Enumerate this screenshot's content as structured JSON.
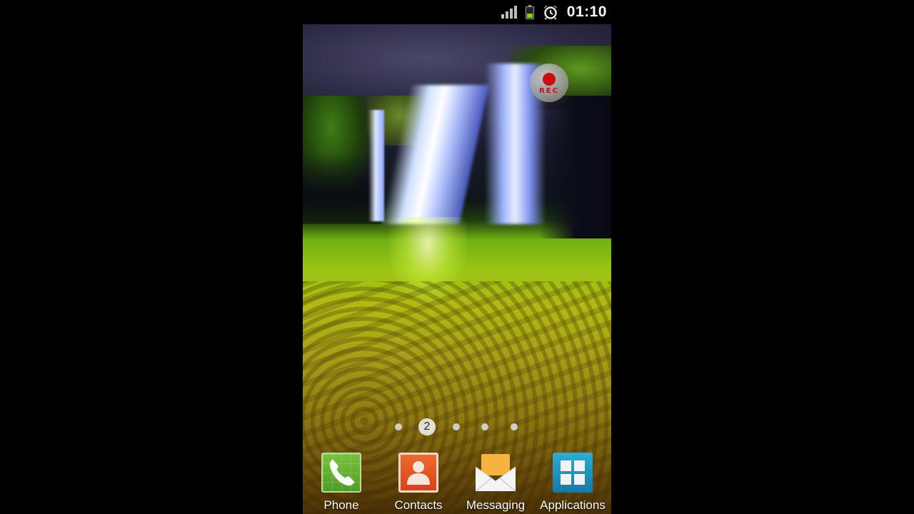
{
  "status_bar": {
    "time": "01:10",
    "signal_icon": "signal-bars-icon",
    "battery_icon": "battery-icon",
    "battery_level": 0.35,
    "alarm_icon": "alarm-clock-icon"
  },
  "overlay": {
    "rec_label": "REC",
    "rec_icon": "record-icon"
  },
  "home": {
    "wallpaper": "waterfall",
    "current_page": "2",
    "page_count": 5
  },
  "dock": {
    "items": [
      {
        "label": "Phone",
        "icon": "phone-icon"
      },
      {
        "label": "Contacts",
        "icon": "contacts-icon"
      },
      {
        "label": "Messaging",
        "icon": "messaging-icon"
      },
      {
        "label": "Applications",
        "icon": "apps-grid-icon"
      }
    ]
  },
  "colors": {
    "rec_red": "#e4000e",
    "battery_green": "#8ad300",
    "phone_green": "#5aab2e",
    "contacts_orange": "#e8521f",
    "messaging_orange": "#f5b340",
    "apps_blue": "#1f96c2"
  }
}
